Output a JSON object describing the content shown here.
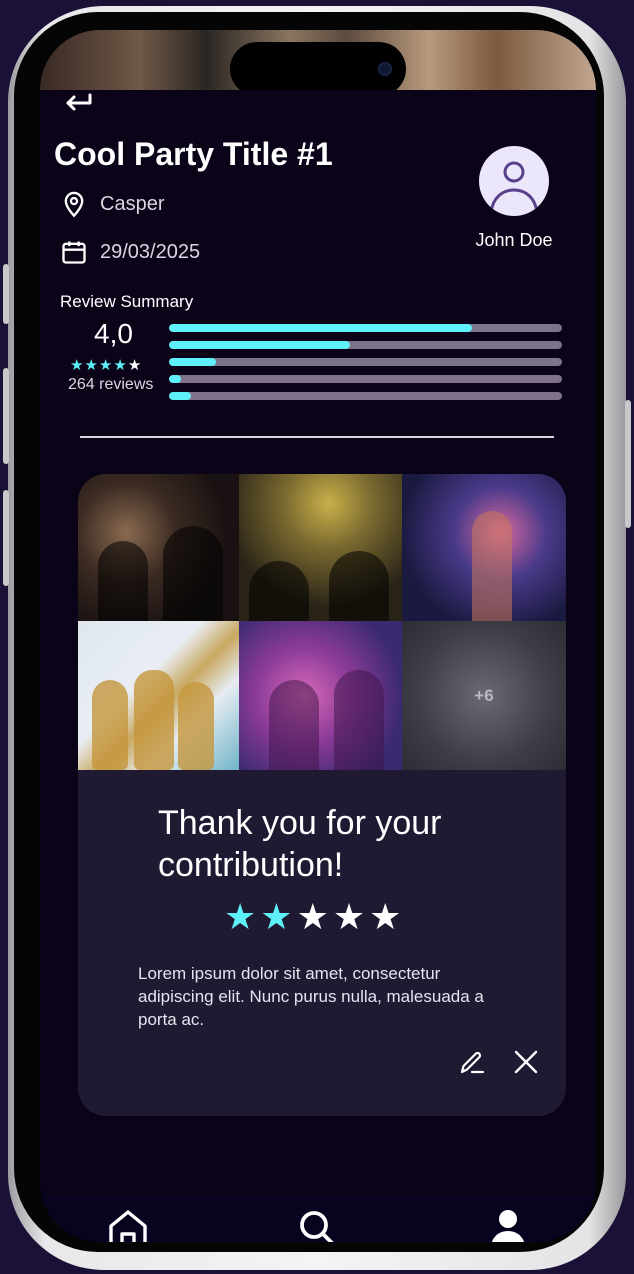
{
  "event": {
    "title": "Cool Party Title #1",
    "location": "Casper",
    "date": "29/03/2025",
    "host_name": "John Doe"
  },
  "review_summary": {
    "label": "Review Summary",
    "average": "4,0",
    "count_text": "264 reviews",
    "distribution": [
      0.77,
      0.46,
      0.12,
      0.03,
      0.055
    ]
  },
  "gallery": {
    "more_count": "+6"
  },
  "contribution": {
    "heading": "Thank you for your contribution!",
    "rating": 2,
    "body": "Lorem ipsum dolor sit amet, consectetur adipiscing elit. Nunc purus nulla, malesuada a porta ac."
  },
  "colors": {
    "accent": "#5ef0f8",
    "background": "#0b0419",
    "card": "#201932",
    "bar_track": "#7e7388"
  },
  "icons": {
    "back": "return-arrow-icon",
    "location": "map-pin-icon",
    "date": "calendar-icon",
    "avatar": "user-icon",
    "edit": "pencil-icon",
    "close": "close-icon",
    "nav": [
      "home-icon",
      "search-icon",
      "profile-icon"
    ]
  }
}
